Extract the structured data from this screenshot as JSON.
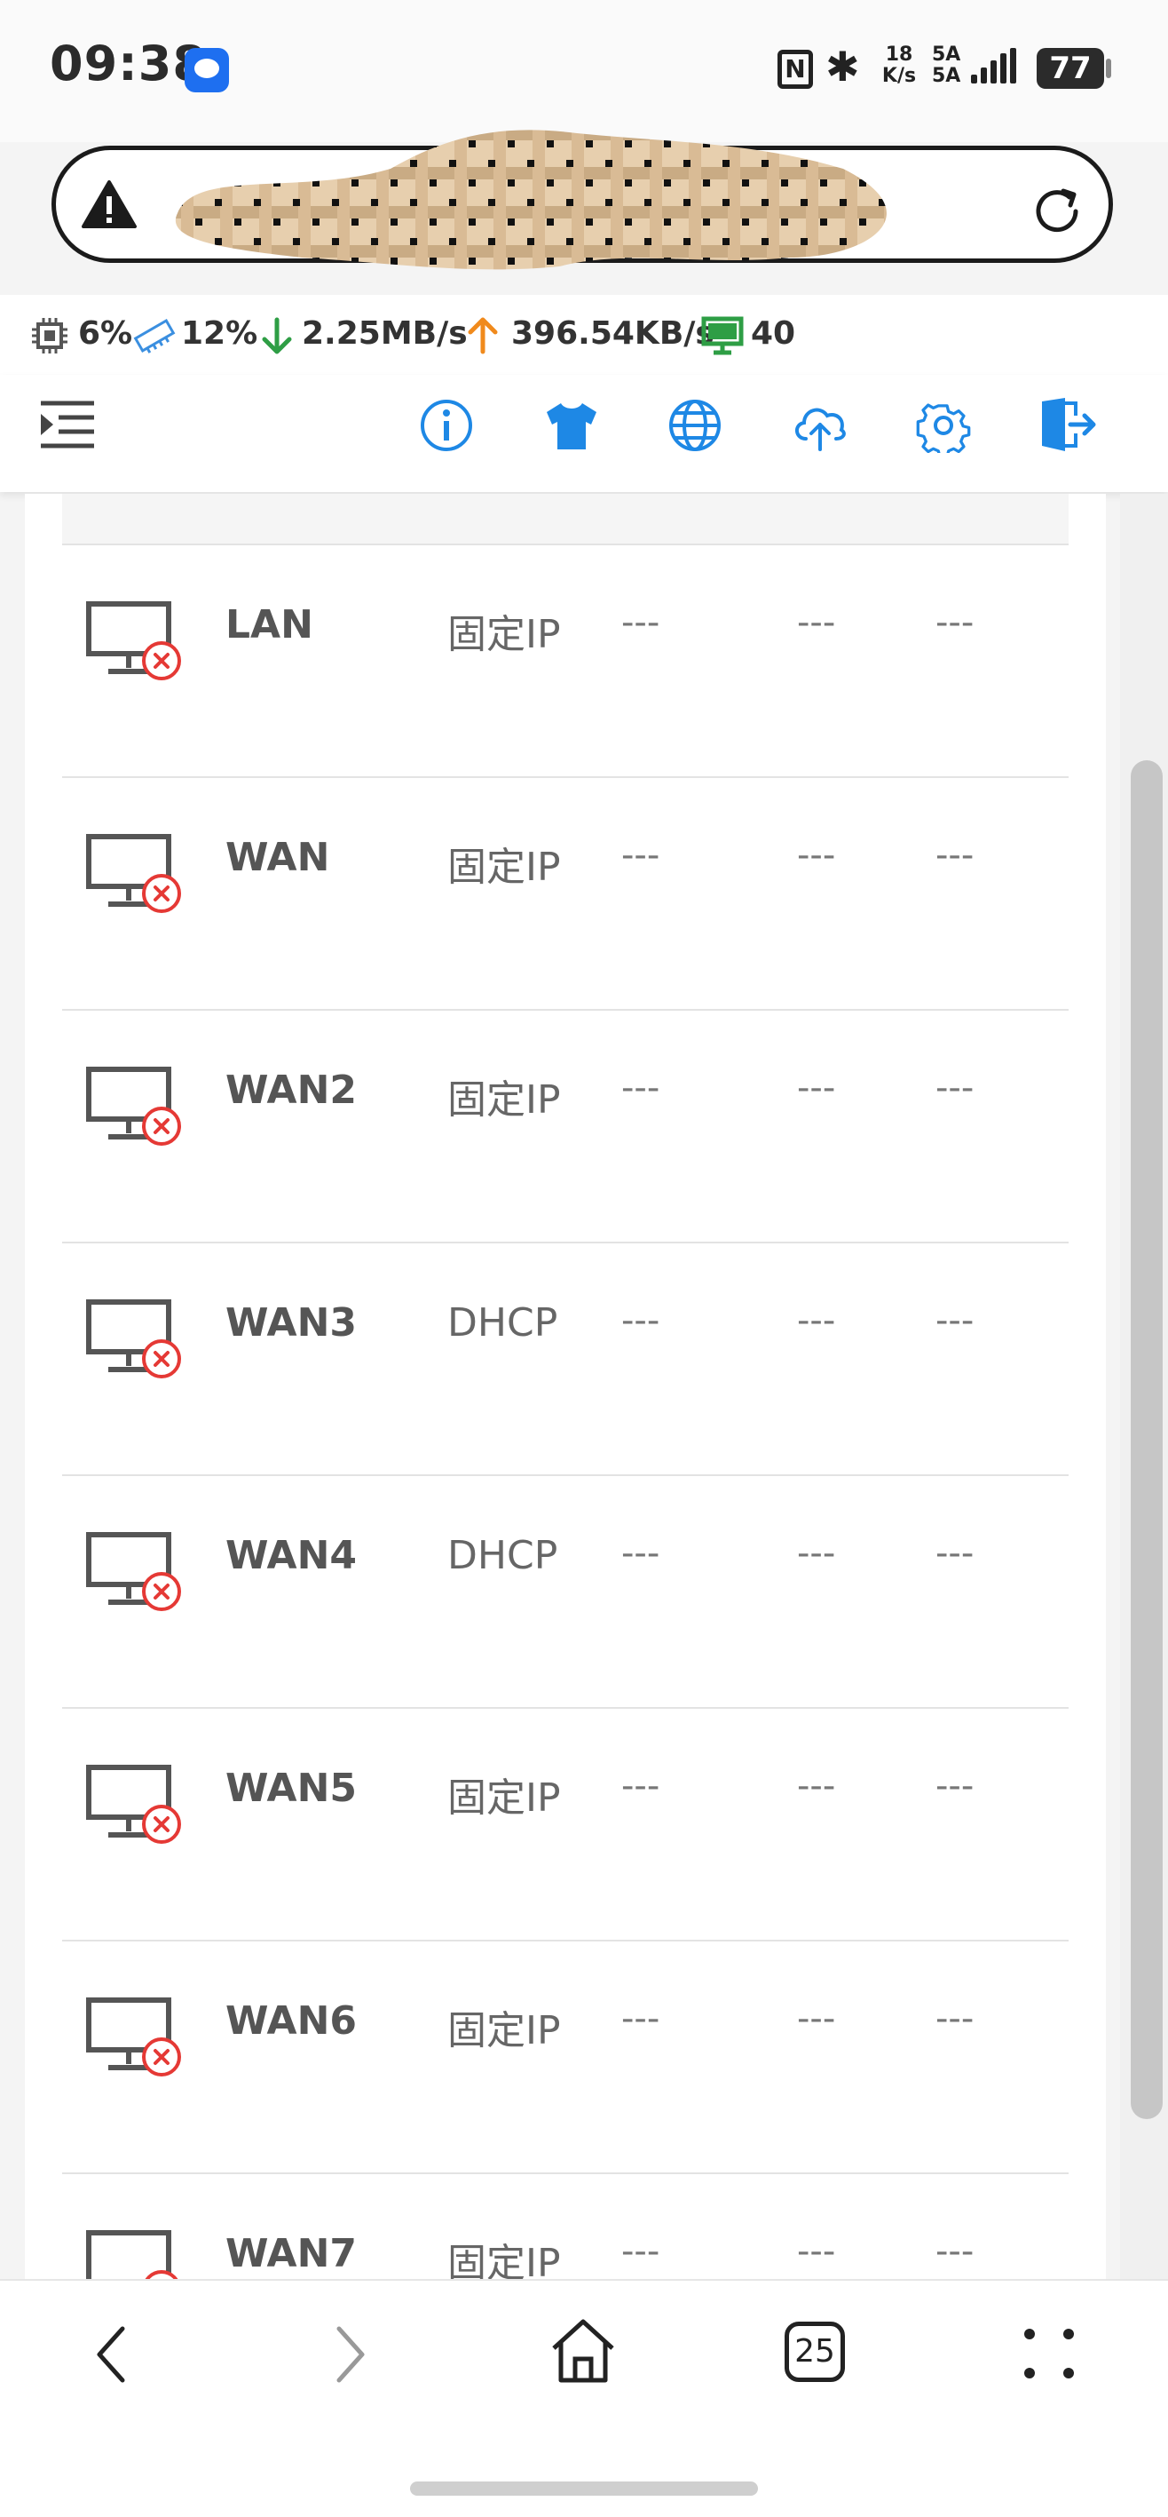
{
  "status_bar": {
    "time": "09:38",
    "net_speed": "18\nK/s",
    "network": "5A\n5A",
    "battery": "77"
  },
  "address_bar": {
    "url": "",
    "warning_icon": "warning-icon",
    "reload_icon": "reload-icon"
  },
  "router_stats": {
    "cpu": "6%",
    "memory": "12%",
    "download": "2.25MB/s",
    "upload": "396.54KB/s",
    "clients": "40"
  },
  "toolbar": {
    "icons": [
      "menu-icon",
      "info-icon",
      "theme-shirt-icon",
      "globe-icon",
      "cloud-upload-icon",
      "settings-gear-icon",
      "logout-icon"
    ]
  },
  "interfaces": [
    {
      "name": "LAN",
      "protocol": "固定IP",
      "c1": "---",
      "c2": "---",
      "c3": "---"
    },
    {
      "name": "WAN",
      "protocol": "固定IP",
      "c1": "---",
      "c2": "---",
      "c3": "---"
    },
    {
      "name": "WAN2",
      "protocol": "固定IP",
      "c1": "---",
      "c2": "---",
      "c3": "---"
    },
    {
      "name": "WAN3",
      "protocol": "DHCP",
      "c1": "---",
      "c2": "---",
      "c3": "---"
    },
    {
      "name": "WAN4",
      "protocol": "DHCP",
      "c1": "---",
      "c2": "---",
      "c3": "---"
    },
    {
      "name": "WAN5",
      "protocol": "固定IP",
      "c1": "---",
      "c2": "---",
      "c3": "---"
    },
    {
      "name": "WAN6",
      "protocol": "固定IP",
      "c1": "---",
      "c2": "---",
      "c3": "---"
    },
    {
      "name": "WAN7",
      "protocol": "固定IP",
      "c1": "---",
      "c2": "---",
      "c3": "---"
    }
  ],
  "bottom_nav": {
    "tab_count": "25"
  },
  "colors": {
    "accent": "#1e88e5",
    "error": "#e53935",
    "download": "#2e9e45",
    "upload": "#f08a1c",
    "clients": "#2e9e45"
  }
}
